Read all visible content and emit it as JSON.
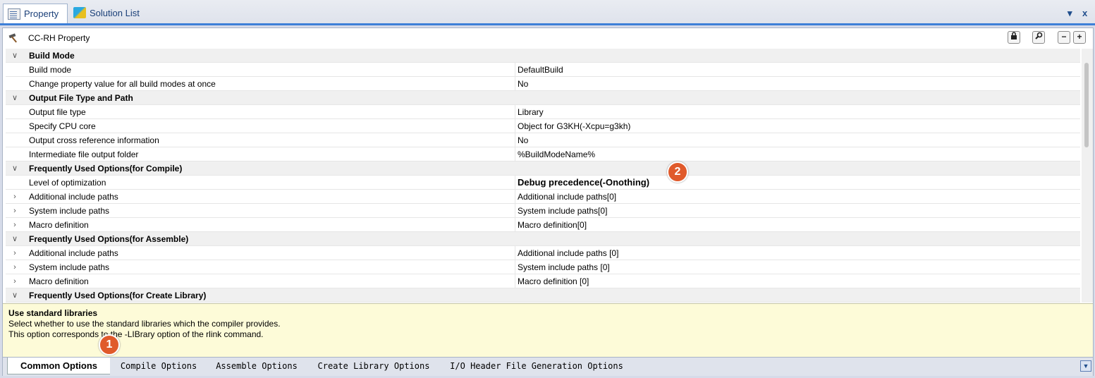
{
  "tabs": [
    {
      "label": "Property",
      "icon": "property-icon"
    },
    {
      "label": "Solution List",
      "icon": "solution-list-icon"
    }
  ],
  "top_controls": {
    "pin": "▾",
    "close": "x"
  },
  "panel": {
    "title": "CC-RH Property",
    "icon": "hammer-icon",
    "buttons": [
      "lock-icon",
      "search-icon",
      "−",
      "+"
    ]
  },
  "rows": [
    {
      "type": "category",
      "name": "Build Mode",
      "expander": "v"
    },
    {
      "type": "item",
      "name": "Build mode",
      "value": "DefaultBuild"
    },
    {
      "type": "item",
      "name": "Change property value for all build modes at once",
      "value": "No"
    },
    {
      "type": "category",
      "name": "Output File Type and Path",
      "expander": "v"
    },
    {
      "type": "item",
      "name": "Output file type",
      "value": "Library"
    },
    {
      "type": "item",
      "name": "Specify CPU core",
      "value": "Object for G3KH(-Xcpu=g3kh)"
    },
    {
      "type": "item",
      "name": "Output cross reference information",
      "value": "No"
    },
    {
      "type": "item",
      "name": "Intermediate file output folder",
      "value": "%BuildModeName%"
    },
    {
      "type": "category",
      "name": "Frequently Used Options(for Compile)",
      "expander": "v"
    },
    {
      "type": "item",
      "name": "Level of optimization",
      "value": "Debug precedence(-Onothing)",
      "bold": true
    },
    {
      "type": "item",
      "name": "Additional include paths",
      "value": "Additional include paths[0]",
      "expander": ">"
    },
    {
      "type": "item",
      "name": "System include paths",
      "value": "System include paths[0]",
      "expander": ">"
    },
    {
      "type": "item",
      "name": "Macro definition",
      "value": "Macro definition[0]",
      "expander": ">"
    },
    {
      "type": "category",
      "name": "Frequently Used Options(for Assemble)",
      "expander": "v"
    },
    {
      "type": "item",
      "name": "Additional include paths",
      "value": "Additional include paths [0]",
      "expander": ">"
    },
    {
      "type": "item",
      "name": "System include paths",
      "value": "System include paths [0]",
      "expander": ">"
    },
    {
      "type": "item",
      "name": "Macro definition",
      "value": "Macro definition [0]",
      "expander": ">"
    },
    {
      "type": "category",
      "name": "Frequently Used Options(for Create Library)",
      "expander": "v"
    }
  ],
  "description": {
    "title": "Use standard libraries",
    "line1": "Select whether to use the standard libraries which the compiler provides.",
    "line2": "This option corresponds to the -LIBrary option of the rlink command."
  },
  "bottom_tabs": [
    "Common Options",
    "Compile Options",
    "Assemble Options",
    "Create Library Options",
    "I/O Header File Generation Options"
  ],
  "badges": [
    "1",
    "2"
  ]
}
